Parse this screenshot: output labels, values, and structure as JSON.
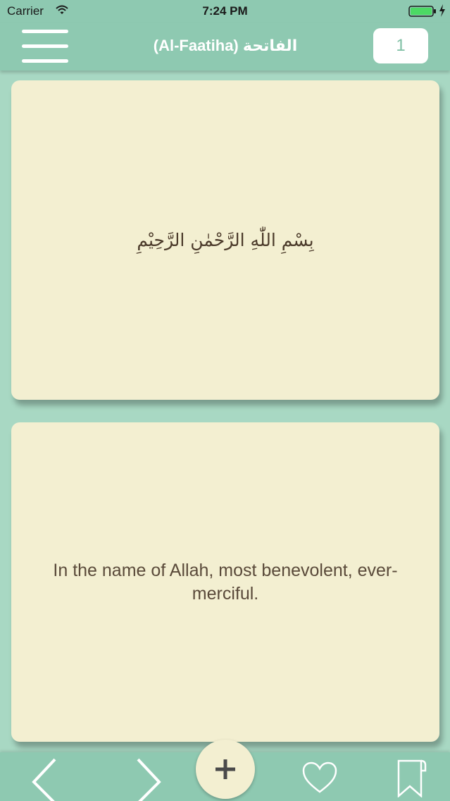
{
  "status_bar": {
    "carrier": "Carrier",
    "time": "7:24 PM",
    "battery_color": "#4cd964"
  },
  "nav_bar": {
    "title": "(Al-Faatiha) الفاتحة",
    "page_number": "1",
    "menu_icon": "hamburger-menu-icon"
  },
  "cards": {
    "arabic": "بِسْمِ اللّٰهِ الرَّحْمٰنِ الرَّحِيْمِ",
    "translation": "In the name of Allah, most benevolent, ever-merciful."
  },
  "toolbar": {
    "prev_icon": "chevron-left-icon",
    "next_icon": "chevron-right-icon",
    "add_icon": "plus-icon",
    "favorite_icon": "heart-icon",
    "bookmark_icon": "bookmark-icon"
  },
  "colors": {
    "bar": "#8ec9b1",
    "background": "#a8d8c3",
    "card": "#f3efd1",
    "text": "#5a4a3a"
  }
}
